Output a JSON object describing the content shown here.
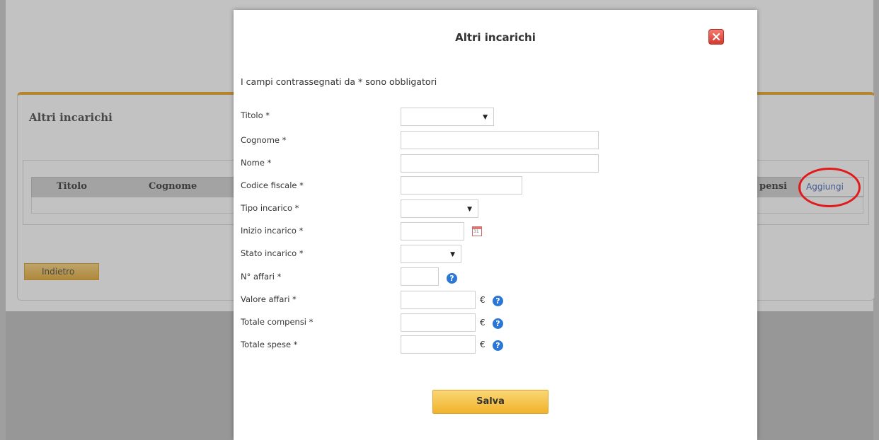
{
  "background": {
    "panel_title": "Altri incarichi",
    "table_headers": {
      "titolo": "Titolo",
      "cognome": "Cognome",
      "compensi": "pensi"
    },
    "add_link": "Aggiungi",
    "back_button": "Indietro"
  },
  "modal": {
    "title": "Altri incarichi",
    "required_note": "I campi contrassegnati da * sono obbligatori",
    "fields": {
      "titolo": {
        "label": "Titolo *",
        "value": ""
      },
      "cognome": {
        "label": "Cognome *",
        "value": ""
      },
      "nome": {
        "label": "Nome *",
        "value": ""
      },
      "codice_fiscale": {
        "label": "Codice fiscale *",
        "value": ""
      },
      "tipo_incarico": {
        "label": "Tipo incarico *",
        "value": ""
      },
      "inizio_incarico": {
        "label": "Inizio incarico *",
        "value": ""
      },
      "stato_incarico": {
        "label": "Stato incarico *",
        "value": ""
      },
      "n_affari": {
        "label": "N° affari *",
        "value": ""
      },
      "valore_affari": {
        "label": "Valore affari *",
        "value": ""
      },
      "totale_compensi": {
        "label": "Totale compensi *",
        "value": ""
      },
      "totale_spese": {
        "label": "Totale spese *",
        "value": ""
      }
    },
    "currency_symbol": "€",
    "help_symbol": "?",
    "calendar_day": "31",
    "save_button": "Salva"
  },
  "colors": {
    "accent_orange": "#f1b32a",
    "close_red": "#d53a2f",
    "help_blue": "#2a77d8",
    "annotation_red": "#e11b1b",
    "link_blue": "#3c62b5"
  },
  "icons": [
    "close-icon",
    "dropdown-caret-icon",
    "calendar-icon",
    "help-icon"
  ]
}
